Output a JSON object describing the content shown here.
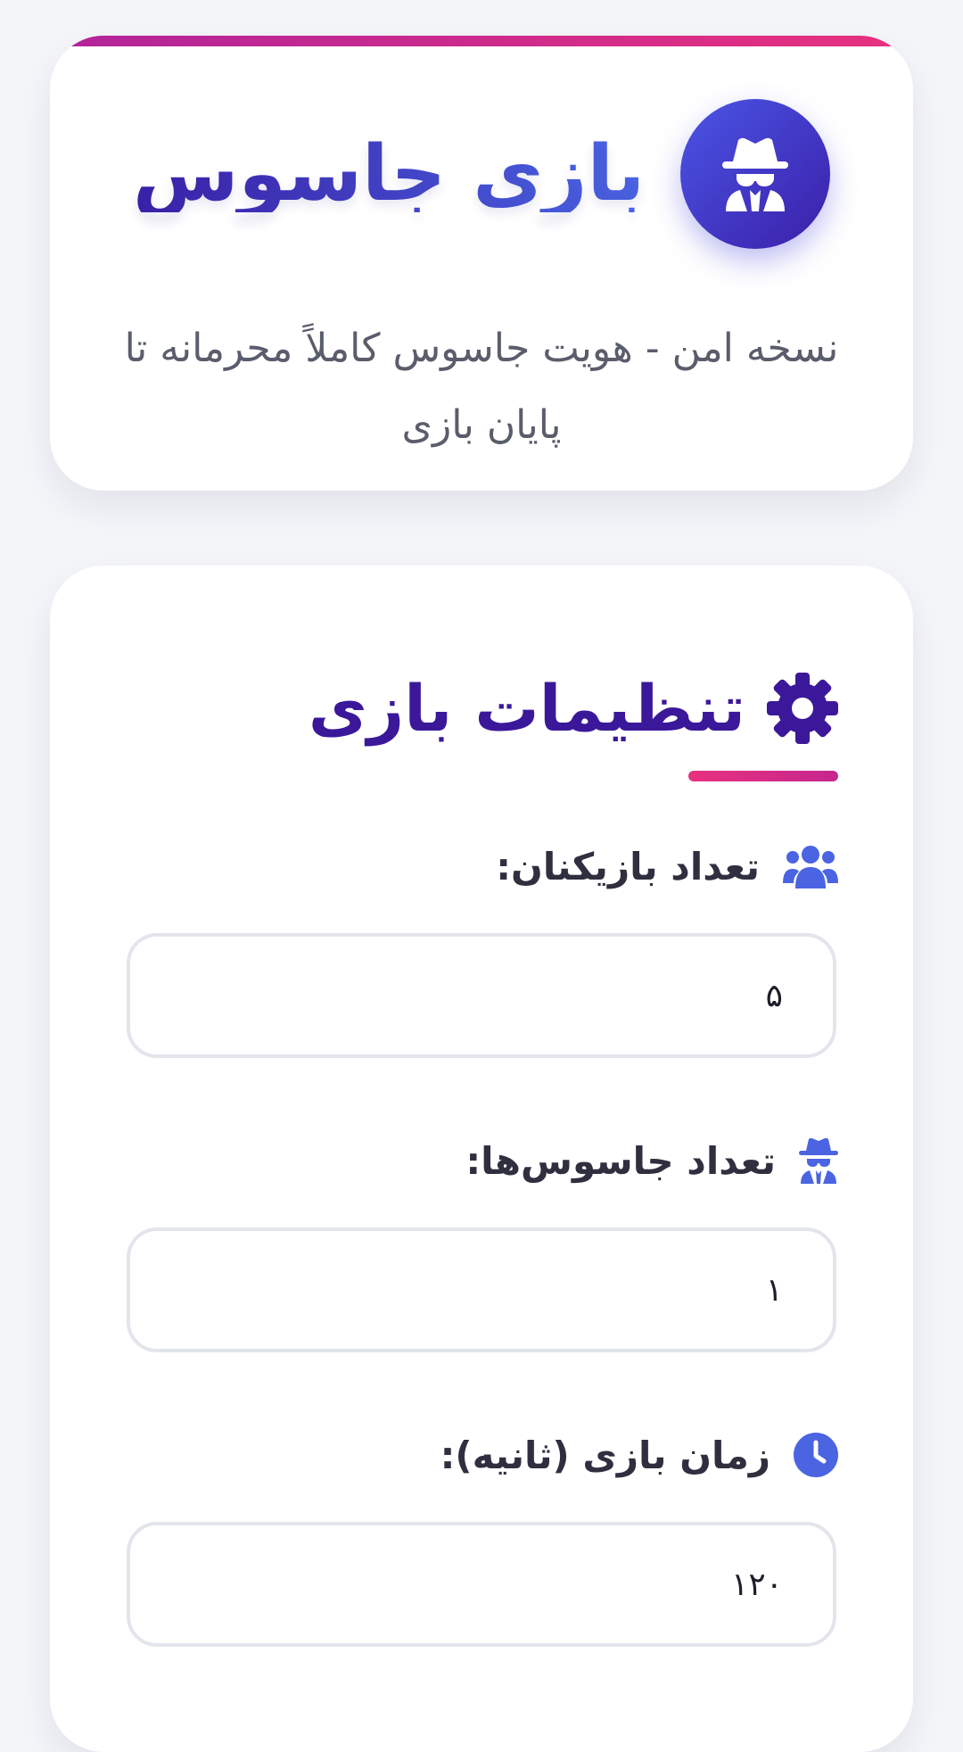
{
  "header": {
    "title": "بازی جاسوس",
    "subtitle": "نسخه امن - هویت جاسوس کاملاً محرمانه تا پایان بازی",
    "accent_colors": [
      "#b1249a",
      "#e8317f"
    ],
    "logo_icon": "spy-icon"
  },
  "settings": {
    "title": "تنظیمات بازی",
    "title_icon": "gear-icon",
    "fields": [
      {
        "label": "تعداد بازیکنان:",
        "icon": "users-icon",
        "value": "۵"
      },
      {
        "label": "تعداد جاسوس‌ها:",
        "icon": "spy-icon",
        "value": "۱"
      },
      {
        "label": "زمان بازی (ثانیه):",
        "icon": "clock-icon",
        "value": "۱۲۰"
      }
    ]
  },
  "colors": {
    "primary": "#3f3cc9",
    "heading": "#3b189a",
    "accent_pink": "#e8317f",
    "icon_blue": "#4a64e2"
  }
}
